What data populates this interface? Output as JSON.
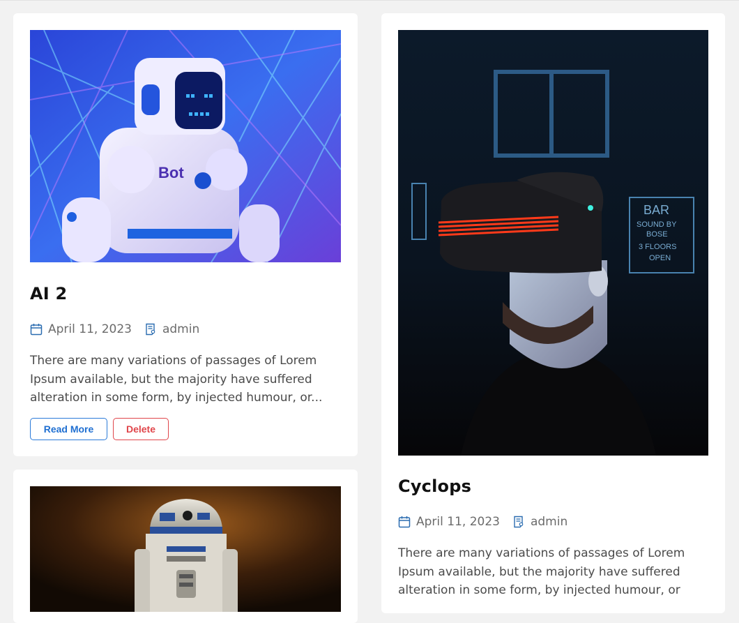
{
  "posts": [
    {
      "title": "AI 2",
      "date": "April 11, 2023",
      "author": "admin",
      "excerpt_lines": [
        "There are many variations of passages of Lorem",
        "Ipsum available, but the majority have suffered",
        "alteration in some form, by injected humour, or..."
      ],
      "read_more_label": "Read More",
      "delete_label": "Delete",
      "image_text": "Bot"
    },
    {
      "title": "Cyclops",
      "date": "April 11, 2023",
      "author": "admin",
      "excerpt_lines": [
        "There are many variations of passages of Lorem",
        "Ipsum available, but the majority have suffered",
        "alteration in some form, by injected humour, or"
      ],
      "image_sign_lines": [
        "BAR",
        "SOUND BY",
        "BOSE",
        "3 FLOORS",
        "OPEN"
      ]
    }
  ],
  "icons": {
    "date": "calendar-icon",
    "author": "author-document-icon"
  },
  "colors": {
    "accent_blue": "#1f6fd1",
    "danger_red": "#e0454a",
    "meta_icon_blue": "#2a6cb0",
    "page_bg": "#f2f2f2",
    "card_bg": "#ffffff"
  }
}
